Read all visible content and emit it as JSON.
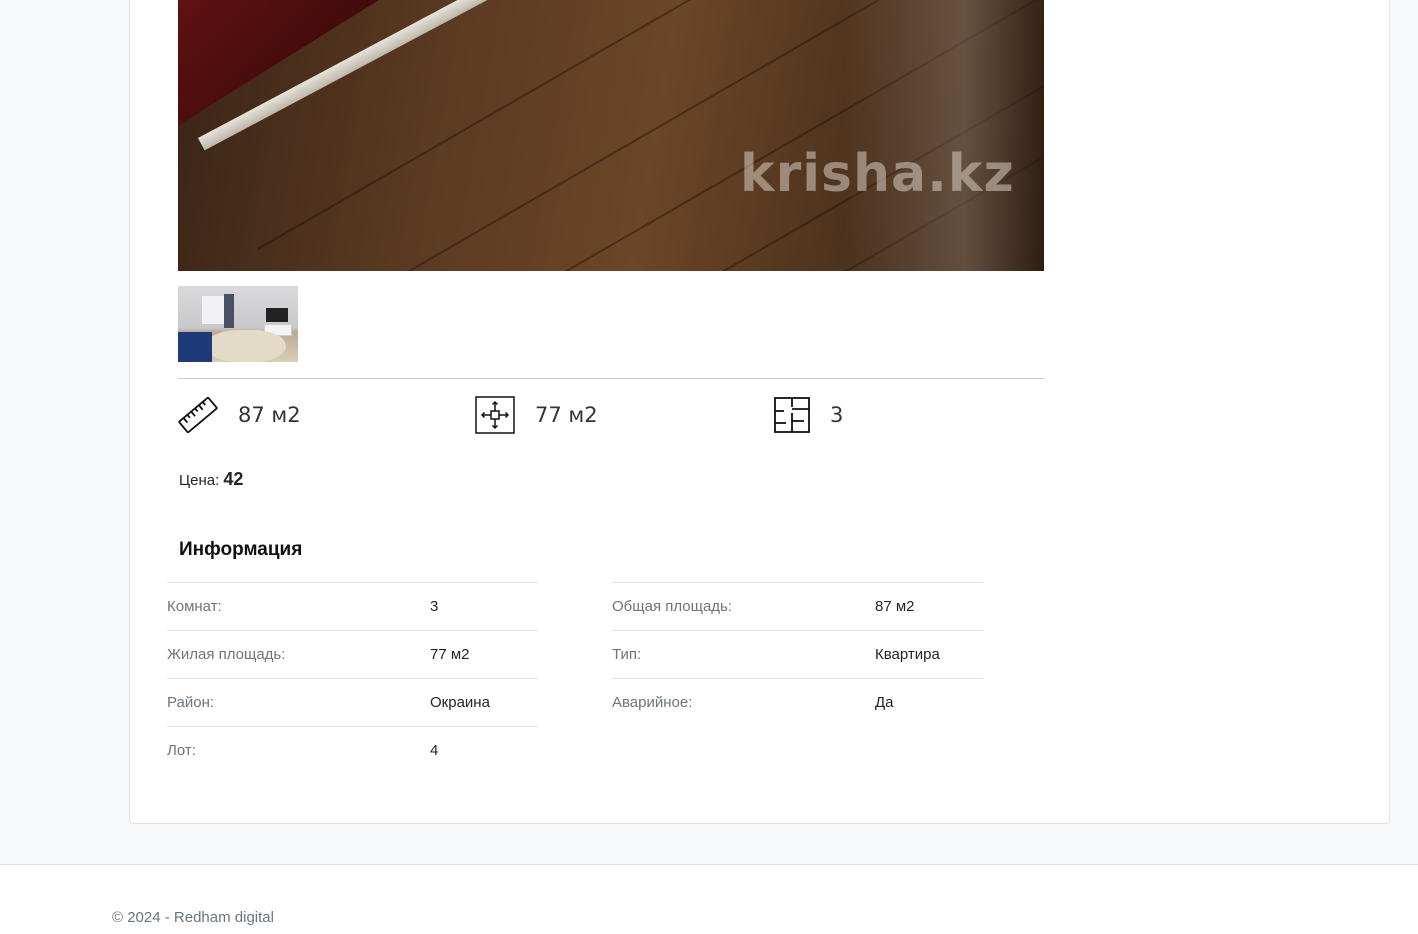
{
  "gallery": {
    "watermark": "krisha.kz",
    "thumbnails": 1
  },
  "features": {
    "total_area": "87 м2",
    "living_area": "77 м2",
    "rooms": "3"
  },
  "price": {
    "label": "Цена:",
    "value": "42"
  },
  "info": {
    "title": "Информация",
    "left": [
      {
        "label": "Комнат:",
        "value": "3"
      },
      {
        "label": "Жилая площадь:",
        "value": "77 м2"
      },
      {
        "label": "Район:",
        "value": "Окраина"
      },
      {
        "label": "Лот:",
        "value": "4"
      }
    ],
    "right": [
      {
        "label": "Общая площадь:",
        "value": "87 м2"
      },
      {
        "label": "Тип:",
        "value": "Квартира"
      },
      {
        "label": "Аварийное:",
        "value": "Да"
      }
    ]
  },
  "footer": {
    "text": "© 2024 - Redham digital"
  }
}
